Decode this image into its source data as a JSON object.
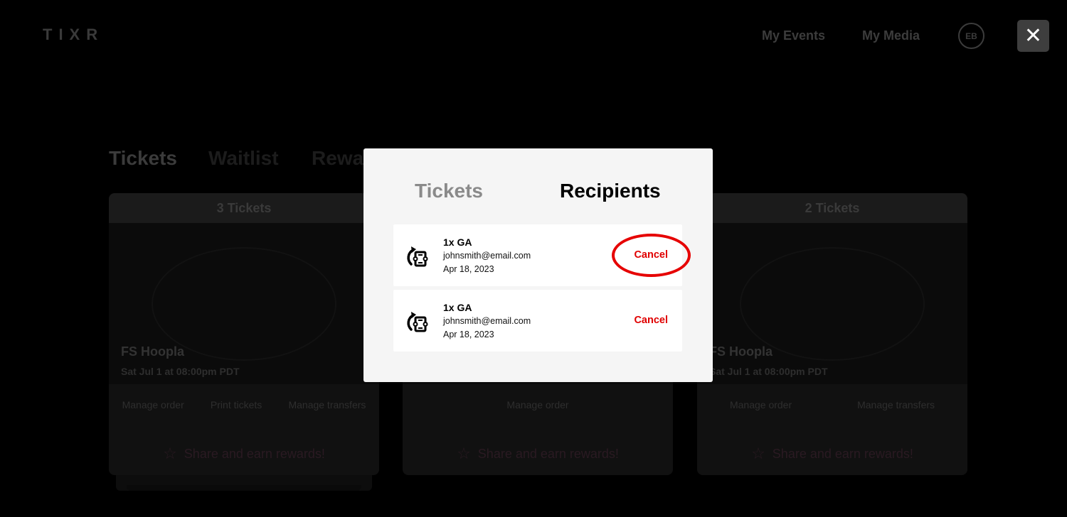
{
  "header": {
    "logo": "TIXR",
    "nav": {
      "events": "My Events",
      "media": "My Media"
    },
    "avatar_initials": "EB",
    "close_symbol": "✕"
  },
  "page_tabs": [
    "Tickets",
    "Waitlist",
    "Rewa"
  ],
  "cards": [
    {
      "count": "3 Tickets",
      "title": "FS Hoopla",
      "date": "Sat Jul 1 at 08:00pm PDT",
      "actions": [
        "Manage order",
        "Print tickets",
        "Manage transfers"
      ],
      "share": "Share and earn rewards!"
    },
    {
      "count": "",
      "title": "",
      "date": "",
      "actions": [
        "Manage order"
      ],
      "share": "Share and earn rewards!"
    },
    {
      "count": "2 Tickets",
      "title": "FS Hoopla",
      "date": "Sat Jul 1 at 08:00pm PDT",
      "actions": [
        "Manage order",
        "Manage transfers"
      ],
      "share": "Share and earn rewards!"
    }
  ],
  "modal": {
    "tabs": {
      "tickets": "Tickets",
      "recipients": "Recipients"
    },
    "recipients": [
      {
        "qty": "1x GA",
        "email": "johnsmith@email.com",
        "date": "Apr 18, 2023",
        "action": "Cancel"
      },
      {
        "qty": "1x GA",
        "email": "johnsmith@email.com",
        "date": "Apr 18, 2023",
        "action": "Cancel"
      }
    ]
  },
  "colors": {
    "accent_red": "#e00000",
    "modal_bg": "#f5f5f5",
    "overlay_bg": "#000000"
  },
  "icons": {
    "close": "close-icon",
    "transfer": "ticket-transfer-icon",
    "star": "star-icon"
  }
}
